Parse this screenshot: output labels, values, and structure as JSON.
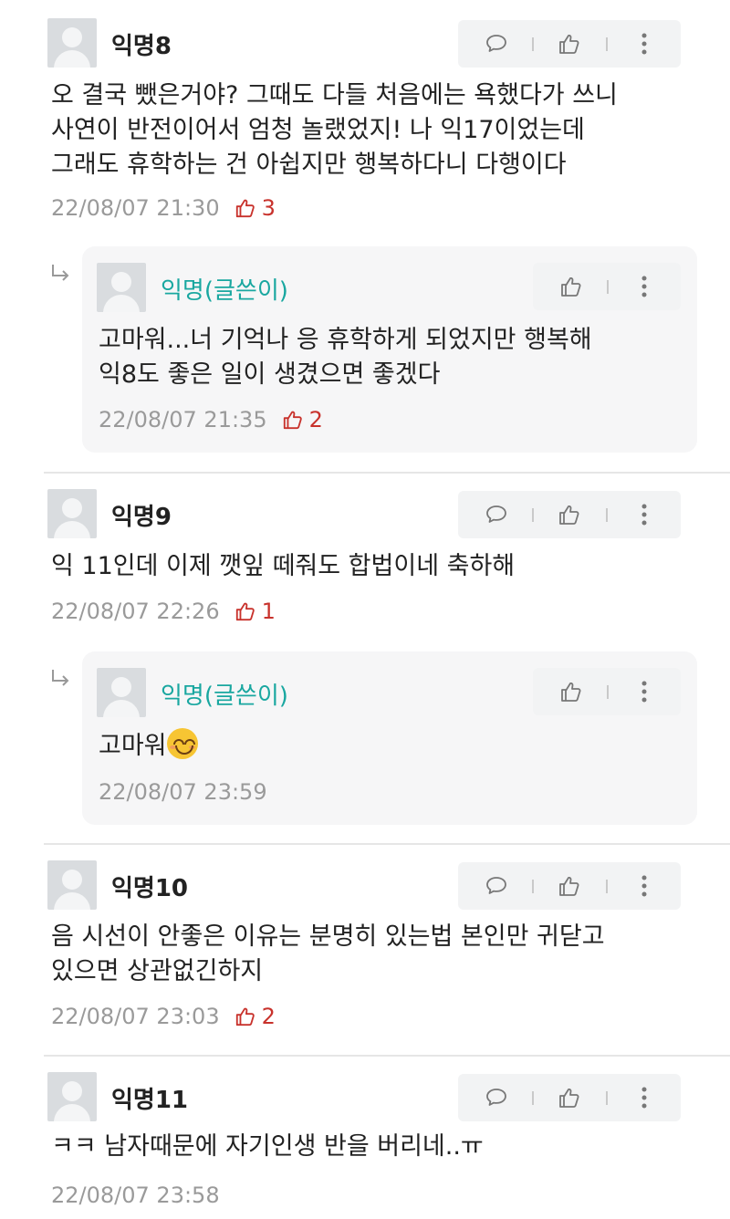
{
  "comments": [
    {
      "name": "익명8",
      "lines": [
        "오 결국 뺐은거야? 그때도 다들 처음에는 욕했다가 쓰니",
        "사연이 반전이어서 엄청 놀랬었지! 나 익17이었는데",
        "그래도 휴학하는 건 아쉽지만 행복하다니 다행이다"
      ],
      "date": "22/08/07 21:30",
      "likes": "3",
      "reply": {
        "name": "익명(글쓴이)",
        "lines": [
          "고마워...너 기억나 응 휴학하게 되었지만 행복해",
          "익8도 좋은 일이 생겼으면 좋겠다"
        ],
        "date": "22/08/07 21:35",
        "likes": "2"
      }
    },
    {
      "name": "익명9",
      "lines": [
        "익 11인데 이제 깻잎 떼줘도 합법이네 축하해"
      ],
      "date": "22/08/07 22:26",
      "likes": "1",
      "reply": {
        "name": "익명(글쓴이)",
        "lines": [
          "고마워"
        ],
        "date": "22/08/07 23:59",
        "likes": ""
      }
    },
    {
      "name": "익명10",
      "lines": [
        "음 시선이 안좋은 이유는 분명히 있는법 본인만 귀닫고",
        "있으면 상관없긴하지"
      ],
      "date": "22/08/07 23:03",
      "likes": "2"
    },
    {
      "name": "익명11",
      "lines": [
        "ㅋㅋ 남자때문에 자기인생 반을 버리네..ㅠ"
      ],
      "date": "22/08/07 23:58",
      "likes": ""
    }
  ],
  "icons": {
    "comment": "speech-bubble-icon",
    "like": "thumbs-up-icon",
    "more": "more-vertical-icon",
    "reply": "reply-arrow-icon",
    "emoji": "smiling-face-icon"
  },
  "colors": {
    "author_name": "#19a7a0",
    "like_count": "#c8322c",
    "meta_text": "#9a9a9a",
    "action_bg": "#f2f3f4",
    "reply_bg": "#f6f6f7"
  }
}
